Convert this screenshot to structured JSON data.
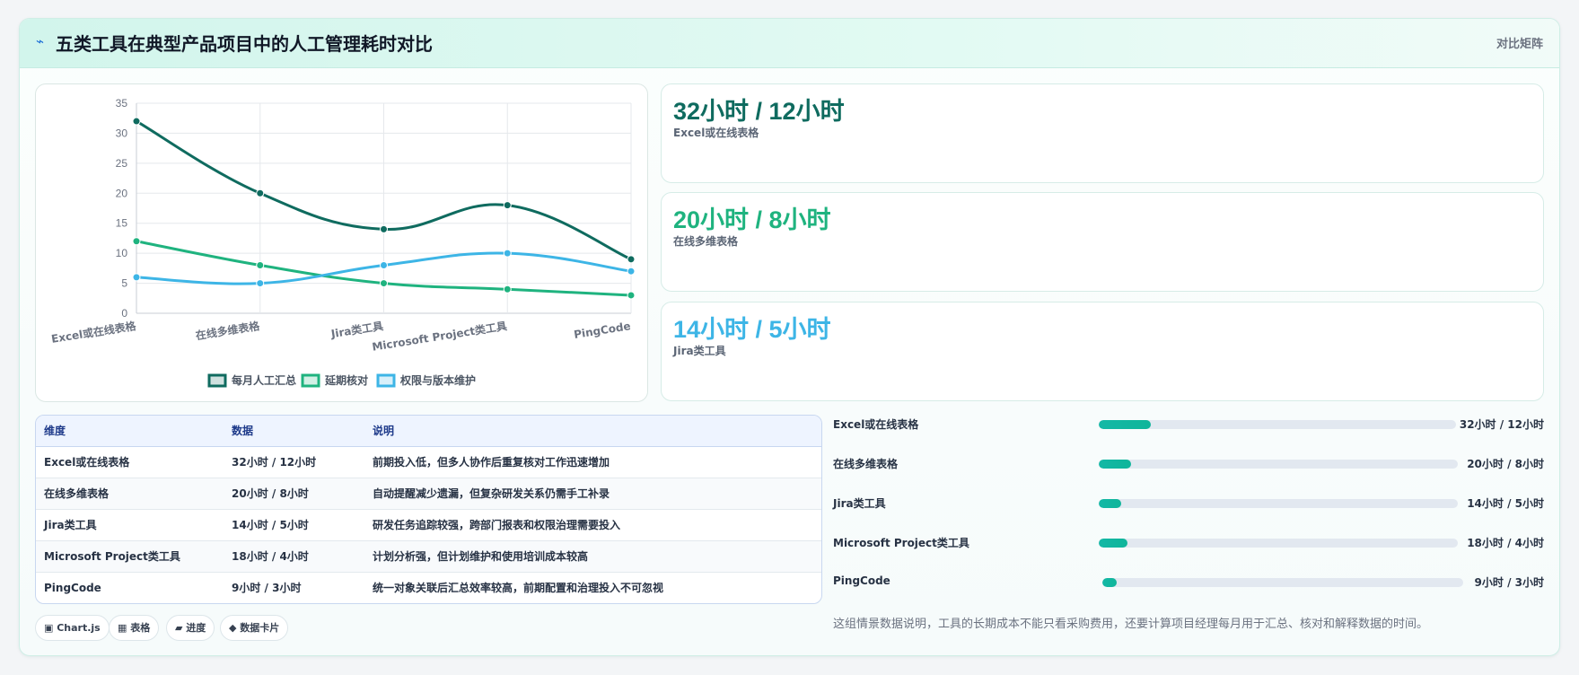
{
  "header": {
    "icon": "bolt-icon",
    "title": "五类工具在典型产品项目中的人工管理耗时对比",
    "tag": "对比矩阵"
  },
  "colors": {
    "series_dark": "#0f6b5f",
    "series_green": "#1fb37f",
    "series_blue": "#3db5e6",
    "progress": "#14b8a6"
  },
  "chart_data": {
    "type": "line",
    "categories": [
      "Excel或在线表格",
      "在线多维表格",
      "Jira类工具",
      "Microsoft Project类工具",
      "PingCode"
    ],
    "series": [
      {
        "name": "每月人工汇总",
        "values": [
          32,
          20,
          14,
          18,
          9
        ],
        "color": "#0f6b5f"
      },
      {
        "name": "延期核对",
        "values": [
          12,
          8,
          5,
          4,
          3
        ],
        "color": "#1fb37f"
      },
      {
        "name": "权限与版本维护",
        "values": [
          6,
          5,
          8,
          10,
          7
        ],
        "color": "#3db5e6"
      }
    ],
    "ylim": [
      0,
      35
    ],
    "yticks": [
      0,
      5,
      10,
      15,
      20,
      25,
      30,
      35
    ],
    "grid": true,
    "legend": "bottom",
    "smooth": true
  },
  "stat_cards": [
    {
      "value": "32小时 / 12小时",
      "label": "Excel或在线表格",
      "color": "#0f6b5f"
    },
    {
      "value": "20小时 / 8小时",
      "label": "在线多维表格",
      "color": "#1fb37f"
    },
    {
      "value": "14小时 / 5小时",
      "label": "Jira类工具",
      "color": "#3db5e6"
    }
  ],
  "table": {
    "headers": [
      "维度",
      "数据",
      "说明"
    ],
    "rows": [
      [
        "Excel或在线表格",
        "32小时 / 12小时",
        "前期投入低，但多人协作后重复核对工作迅速增加"
      ],
      [
        "在线多维表格",
        "20小时 / 8小时",
        "自动提醒减少遗漏，但复杂研发关系仍需手工补录"
      ],
      [
        "Jira类工具",
        "14小时 / 5小时",
        "研发任务追踪较强，跨部门报表和权限治理需要投入"
      ],
      [
        "Microsoft Project类工具",
        "18小时 / 4小时",
        "计划分析强，但计划维护和使用培训成本较高"
      ],
      [
        "PingCode",
        "9小时 / 3小时",
        "统一对象关联后汇总效率较高，前期配置和治理投入不可忽视"
      ]
    ]
  },
  "chips": [
    "▣ Chart.js",
    "▦ 表格",
    "▰ 进度",
    "◆ 数据卡片"
  ],
  "progress": [
    {
      "label": "Excel或在线表格",
      "value": "32小时 / 12小时",
      "fraction": 0.145
    },
    {
      "label": "在线多维表格",
      "value": "20小时 / 8小时",
      "fraction": 0.09
    },
    {
      "label": "Jira类工具",
      "value": "14小时 / 5小时",
      "fraction": 0.063
    },
    {
      "label": "Microsoft Project类工具",
      "value": "18小时 / 4小时",
      "fraction": 0.081
    },
    {
      "label": "PingCode",
      "value": "9小时 / 3小时",
      "fraction": 0.041
    }
  ],
  "note": "这组情景数据说明，工具的长期成本不能只看采购费用，还要计算项目经理每月用于汇总、核对和解释数据的时间。"
}
